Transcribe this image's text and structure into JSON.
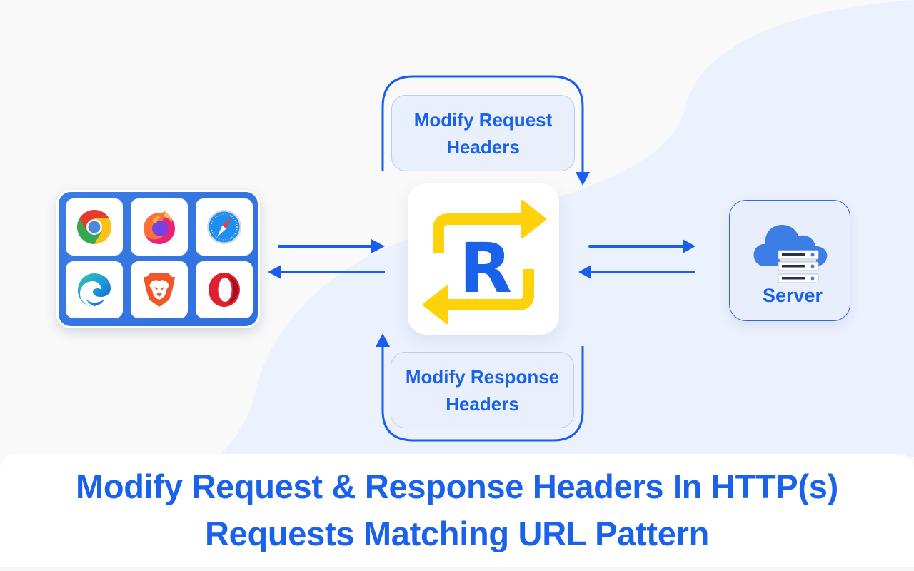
{
  "diagram": {
    "title_lines": [
      "Modify Request & Response Headers In HTTP(s)",
      "Requests Matching URL Pattern"
    ],
    "request_label": [
      "Modify Request",
      "Headers"
    ],
    "response_label": [
      "Modify Response",
      "Headers"
    ],
    "server_label": "Server",
    "center_app": {
      "letter": "R",
      "icon": "requestly-swap-arrows-icon"
    },
    "browsers": [
      {
        "name": "Chrome",
        "icon": "chrome-icon"
      },
      {
        "name": "Firefox",
        "icon": "firefox-icon"
      },
      {
        "name": "Safari",
        "icon": "safari-icon"
      },
      {
        "name": "Edge",
        "icon": "edge-icon"
      },
      {
        "name": "Brave",
        "icon": "brave-icon"
      },
      {
        "name": "Opera",
        "icon": "opera-icon"
      }
    ],
    "flows": [
      {
        "from": "Browsers",
        "to": "Requestly",
        "direction": "right"
      },
      {
        "from": "Requestly",
        "to": "Browsers",
        "direction": "left"
      },
      {
        "from": "Requestly",
        "to": "Server",
        "direction": "right"
      },
      {
        "from": "Server",
        "to": "Requestly",
        "direction": "left"
      },
      {
        "from": "Request loop",
        "to": "Requestly",
        "label": "Modify Request Headers",
        "direction": "down"
      },
      {
        "from": "Response loop",
        "to": "Requestly",
        "label": "Modify Response Headers",
        "direction": "up"
      }
    ],
    "colors": {
      "accent_blue": "#1b62ea",
      "arrow_blue": "#1a5eef",
      "panel_blue": "#3478e3",
      "yellow": "#fdd20a",
      "label_bg": "#e9effb",
      "blob_bg": "#ebf1fd",
      "page_bg": "#f9f9f9"
    }
  }
}
